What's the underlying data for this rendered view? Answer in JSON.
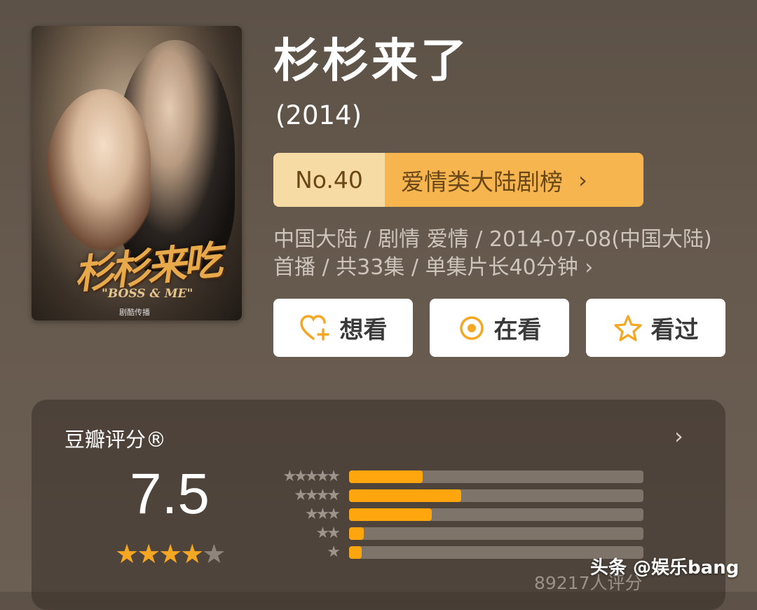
{
  "poster": {
    "title_art": "杉杉来吃",
    "subtitle_art": "\"BOSS & ME\"",
    "studio": "剧酷传播"
  },
  "title": "杉杉来了",
  "year": "(2014)",
  "ranking": {
    "number": "No.40",
    "category": "爱情类大陆剧榜"
  },
  "meta": "中国大陆 / 剧情 爱情 / 2014-07-08(中国大陆)首播 / 共33集 / 单集片长40分钟",
  "actions": {
    "want": "想看",
    "watching": "在看",
    "watched": "看过"
  },
  "rating": {
    "title": "豆瓣评分®",
    "score": "7.5",
    "stars": 4,
    "count": "89217人评分",
    "distribution": [
      {
        "stars": 5,
        "fraction": 0.25
      },
      {
        "stars": 4,
        "fraction": 0.38
      },
      {
        "stars": 3,
        "fraction": 0.28
      },
      {
        "stars": 2,
        "fraction": 0.05
      },
      {
        "stars": 1,
        "fraction": 0.04
      }
    ]
  },
  "watermark": "头条 @娱乐bang",
  "colors": {
    "accent": "#ffa50e",
    "rank_light": "#f7dba4",
    "rank_dark": "#f7b54f"
  }
}
